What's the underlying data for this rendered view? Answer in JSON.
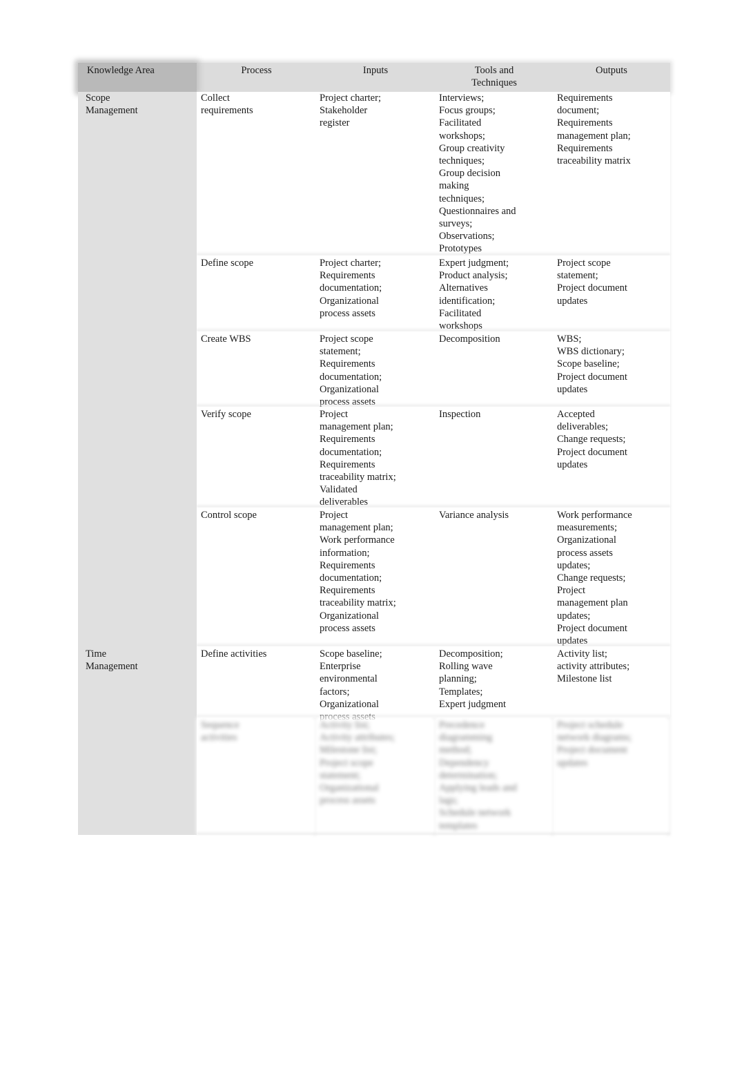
{
  "table": {
    "headers": [
      "Knowledge Area",
      "Process",
      "Inputs",
      "Tools and\nTechniques",
      "Outputs"
    ],
    "rows": [
      {
        "knowledge_area": "Scope\nManagement",
        "process": "Collect\nrequirements",
        "inputs": "Project charter;\nStakeholder\nregister",
        "tools": "Interviews;\nFocus groups;\nFacilitated\nworkshops;\nGroup creativity\ntechniques;\nGroup decision\nmaking\ntechniques;\nQuestionnaires and\nsurveys;\nObservations;\nPrototypes",
        "outputs": "Requirements\ndocument;\nRequirements\nmanagement plan;\nRequirements\ntraceability matrix"
      },
      {
        "knowledge_area": "",
        "process": "Define scope",
        "inputs": "Project charter;\nRequirements\ndocumentation;\nOrganizational\nprocess assets",
        "tools": "Expert judgment;\nProduct analysis;\nAlternatives\nidentification;\nFacilitated\nworkshops",
        "outputs": "Project scope\nstatement;\nProject document\nupdates"
      },
      {
        "knowledge_area": "",
        "process": "Create WBS",
        "inputs": "Project scope\nstatement;\nRequirements\ndocumentation;\nOrganizational\nprocess assets",
        "tools": "Decomposition",
        "outputs": "WBS;\nWBS dictionary;\nScope baseline;\nProject document\nupdates"
      },
      {
        "knowledge_area": "",
        "process": "Verify scope",
        "inputs": "Project\nmanagement plan;\nRequirements\ndocumentation;\nRequirements\ntraceability matrix;\nValidated\ndeliverables",
        "tools": "Inspection",
        "outputs": "Accepted\ndeliverables;\nChange requests;\nProject document\nupdates"
      },
      {
        "knowledge_area": "",
        "process": "Control scope",
        "inputs": "Project\nmanagement plan;\nWork performance\ninformation;\nRequirements\ndocumentation;\nRequirements\ntraceability matrix;\nOrganizational\nprocess assets",
        "tools": "Variance analysis",
        "outputs": "Work performance\nmeasurements;\nOrganizational\nprocess assets\nupdates;\nChange requests;\nProject\nmanagement plan\nupdates;\nProject document\nupdates"
      },
      {
        "knowledge_area": "Time\nManagement",
        "process": "Define activities",
        "inputs": "Scope baseline;\nEnterprise\nenvironmental\nfactors;\nOrganizational\nprocess assets",
        "tools": "Decomposition;\nRolling wave\nplanning;\nTemplates;\nExpert judgment",
        "outputs": "Activity list;\nactivity attributes;\nMilestone list"
      },
      {
        "knowledge_area": "",
        "process": "Sequence\nactivities",
        "inputs": "Activity list;\nActivity attributes;\nMilestone list;\nProject scope\nstatement;\nOrganizational\nprocess assets",
        "tools": "Precedence\ndiagramming\nmethod;\nDependency\ndetermination;\nApplying leads and\nlags;\nSchedule network\ntemplates",
        "outputs": "Project schedule\nnetwork diagrams;\nProject document\nupdates",
        "blurred": true
      }
    ]
  }
}
